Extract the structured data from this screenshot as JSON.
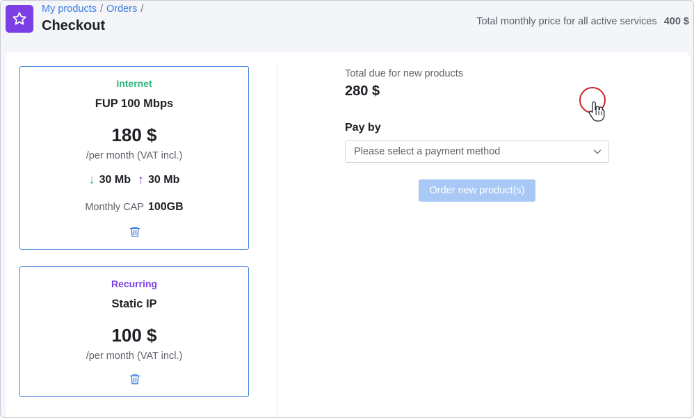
{
  "header": {
    "breadcrumb": [
      {
        "label": "My products"
      },
      {
        "label": "Orders"
      }
    ],
    "breadcrumb_separator": "/",
    "title": "Checkout",
    "total_monthly_label": "Total monthly price for all active services",
    "total_monthly_value": "400 $",
    "app_icon": "star-icon",
    "accent_color": "#7b3fe4"
  },
  "products": [
    {
      "category": "Internet",
      "category_color": "#2cb67d",
      "name": "FUP 100 Mbps",
      "price": "180 $",
      "period": "/per month (VAT incl.)",
      "download": "30 Mb",
      "upload": "30 Mb",
      "cap_label": "Monthly CAP",
      "cap_value": "100GB",
      "delete_icon": "trash-icon"
    },
    {
      "category": "Recurring",
      "category_color": "#7b3fe4",
      "name": "Static IP",
      "price": "100 $",
      "period": "/per month (VAT incl.)",
      "delete_icon": "trash-icon"
    }
  ],
  "checkout": {
    "due_label": "Total due for new products",
    "due_value": "280 $",
    "pay_by_label": "Pay by",
    "payment_select_placeholder": "Please select a payment method",
    "order_button_label": "Order new product(s)"
  }
}
